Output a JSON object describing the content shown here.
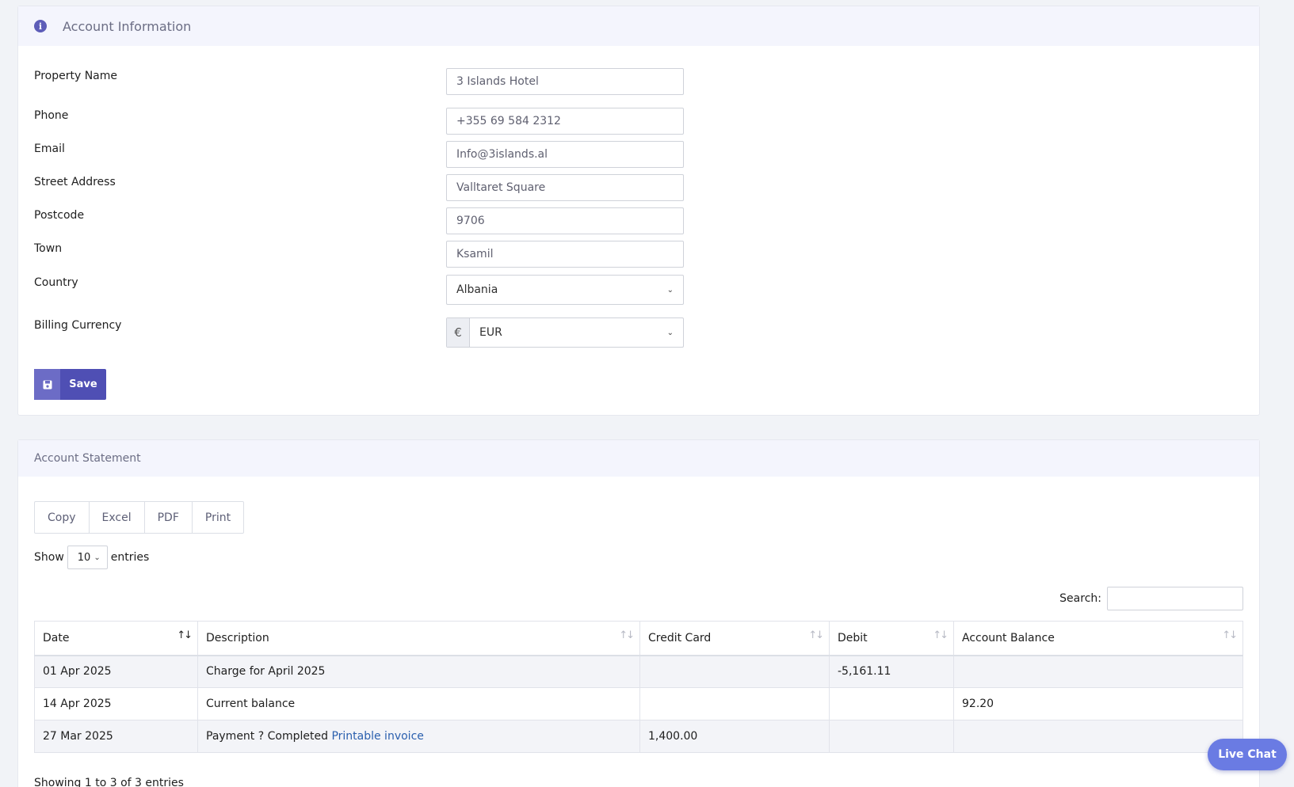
{
  "account_info": {
    "title": "Account Information",
    "fields": [
      {
        "label": "Property Name",
        "value": "3 Islands Hotel"
      },
      {
        "label": "Phone",
        "value": "+355 69 584 2312"
      },
      {
        "label": "Email",
        "value": "Info@3islands.al"
      },
      {
        "label": "Street Address",
        "value": "Valltaret Square"
      },
      {
        "label": "Postcode",
        "value": "9706"
      },
      {
        "label": "Town",
        "value": "Ksamil"
      }
    ],
    "country": {
      "label": "Country",
      "value": "Albania"
    },
    "currency": {
      "label": "Billing Currency",
      "symbol": "€",
      "value": "EUR"
    },
    "save_label": "Save"
  },
  "statement": {
    "title": "Account Statement",
    "export_buttons": [
      "Copy",
      "Excel",
      "PDF",
      "Print"
    ],
    "show_label": "Show",
    "entries_value": "10",
    "entries_label": "entries",
    "search_label": "Search:",
    "columns": [
      "Date",
      "Description",
      "Credit Card",
      "Debit",
      "Account Balance"
    ],
    "rows": [
      {
        "date": "01 Apr 2025",
        "description": "Charge for April 2025",
        "link": "",
        "credit": "",
        "debit": "-5,161.11",
        "balance": ""
      },
      {
        "date": "14 Apr 2025",
        "description": "Current balance",
        "link": "",
        "credit": "",
        "debit": "",
        "balance": "92.20"
      },
      {
        "date": "27 Mar 2025",
        "description": "Payment ? Completed",
        "link": "Printable invoice",
        "credit": "1,400.00",
        "debit": "",
        "balance": ""
      }
    ],
    "info": "Showing 1 to 3 of 3 entries"
  },
  "live_chat": "Live Chat"
}
